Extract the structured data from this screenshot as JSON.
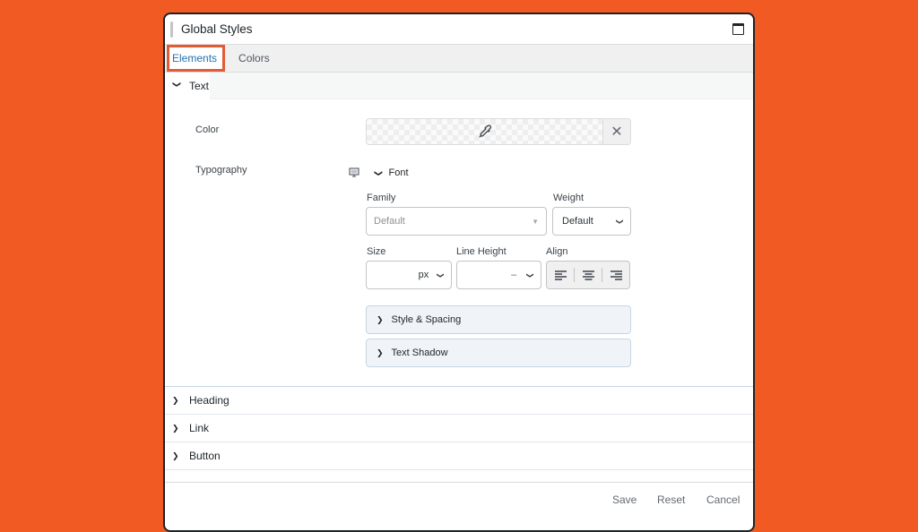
{
  "window": {
    "title": "Global Styles",
    "window_icon": "window-maximize-icon"
  },
  "tabs": [
    {
      "label": "Elements",
      "active": true
    },
    {
      "label": "Colors",
      "active": false
    }
  ],
  "sections": {
    "text": {
      "label": "Text",
      "expanded": true,
      "color": {
        "label": "Color",
        "picker_icon": "eyedropper-icon",
        "clear_icon": "close-icon"
      },
      "typography": {
        "label": "Typography",
        "device_icon": "desktop-monitor-icon",
        "font_toggle": "Font",
        "family": {
          "label": "Family",
          "value": "Default"
        },
        "weight": {
          "label": "Weight",
          "value": "Default"
        },
        "size": {
          "label": "Size",
          "unit": "px"
        },
        "line_height": {
          "label": "Line Height",
          "value": "–"
        },
        "align": {
          "label": "Align",
          "options": [
            "align-left-icon",
            "align-center-icon",
            "align-right-icon"
          ]
        },
        "style_spacing": "Style & Spacing",
        "text_shadow": "Text Shadow"
      }
    },
    "heading": {
      "label": "Heading"
    },
    "link": {
      "label": "Link"
    },
    "button": {
      "label": "Button"
    }
  },
  "footer": {
    "save": "Save",
    "reset": "Reset",
    "cancel": "Cancel"
  },
  "colors": {
    "background": "#f15a22",
    "accent": "#2271b1",
    "highlight": "#e35b32"
  }
}
